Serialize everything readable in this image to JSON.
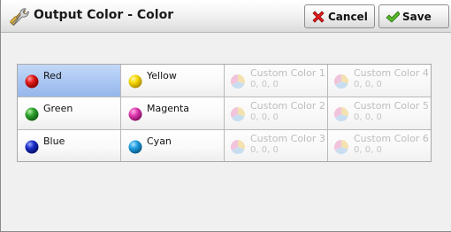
{
  "header": {
    "title": "Output Color - Color",
    "title_icon": "tools-icon",
    "cancel_label": "Cancel",
    "cancel_icon": "red-x-icon",
    "save_label": "Save",
    "save_icon": "green-check-icon"
  },
  "colors": [
    {
      "label": "Red",
      "color": "#d81818",
      "selected": true
    },
    {
      "label": "Green",
      "color": "#2fa32f",
      "selected": false
    },
    {
      "label": "Blue",
      "color": "#1a2fc8",
      "selected": false
    },
    {
      "label": "Yellow",
      "color": "#f5d900",
      "selected": false
    },
    {
      "label": "Magenta",
      "color": "#e03ab0",
      "selected": false
    },
    {
      "label": "Cyan",
      "color": "#1f9ee0",
      "selected": false
    }
  ],
  "custom_colors": [
    {
      "label": "Custom Color 1",
      "value": "0, 0, 0",
      "enabled": false
    },
    {
      "label": "Custom Color 2",
      "value": "0, 0, 0",
      "enabled": false
    },
    {
      "label": "Custom Color 3",
      "value": "0, 0, 0",
      "enabled": false
    },
    {
      "label": "Custom Color 4",
      "value": "0, 0, 0",
      "enabled": false
    },
    {
      "label": "Custom Color 5",
      "value": "0, 0, 0",
      "enabled": false
    },
    {
      "label": "Custom Color 6",
      "value": "0, 0, 0",
      "enabled": false
    }
  ]
}
